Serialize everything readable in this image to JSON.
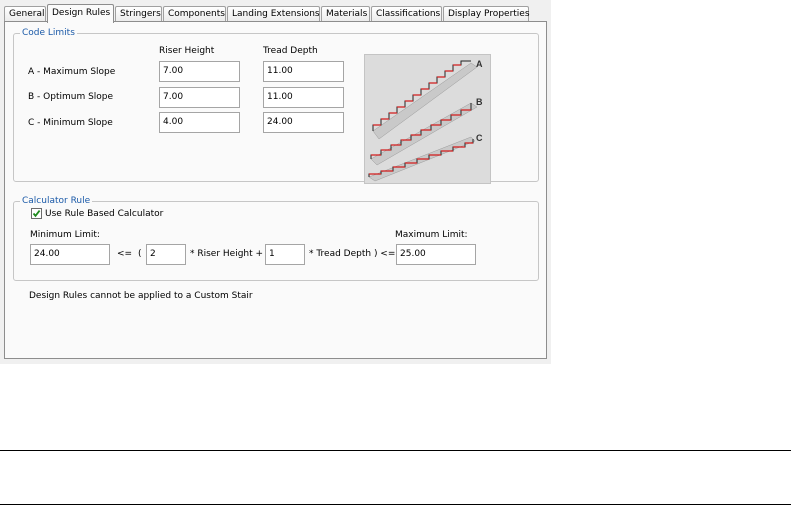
{
  "tabs": [
    {
      "label": "General"
    },
    {
      "label": "Design Rules",
      "active": true
    },
    {
      "label": "Stringers"
    },
    {
      "label": "Components"
    },
    {
      "label": "Landing Extensions"
    },
    {
      "label": "Materials"
    },
    {
      "label": "Classifications"
    },
    {
      "label": "Display Properties"
    }
  ],
  "code_limits": {
    "title": "Code Limits",
    "col_riser": "Riser Height",
    "col_tread": "Tread Depth",
    "rows": [
      {
        "label": "A - Maximum Slope",
        "riser": "7.00",
        "tread": "11.00"
      },
      {
        "label": "B - Optimum Slope",
        "riser": "7.00",
        "tread": "11.00"
      },
      {
        "label": "C - Minimum Slope",
        "riser": "4.00",
        "tread": "24.00"
      }
    ],
    "diagram_labels": [
      "A",
      "B",
      "C"
    ]
  },
  "calculator": {
    "title": "Calculator Rule",
    "checkbox_label": "Use Rule Based Calculator",
    "checked": true,
    "min_label": "Minimum Limit:",
    "max_label": "Maximum Limit:",
    "min_value": "24.00",
    "op1": "<=",
    "paren": "(",
    "riser_mult": "2",
    "riser_text": "* Riser Height +",
    "tread_mult": "1",
    "tread_text": "* Tread Depth ) <=",
    "max_value": "25.00"
  },
  "note": "Design Rules cannot be applied to a Custom Stair",
  "colors": {
    "accent": "#1b5aa8",
    "stair_edge": "#d31c1c"
  }
}
